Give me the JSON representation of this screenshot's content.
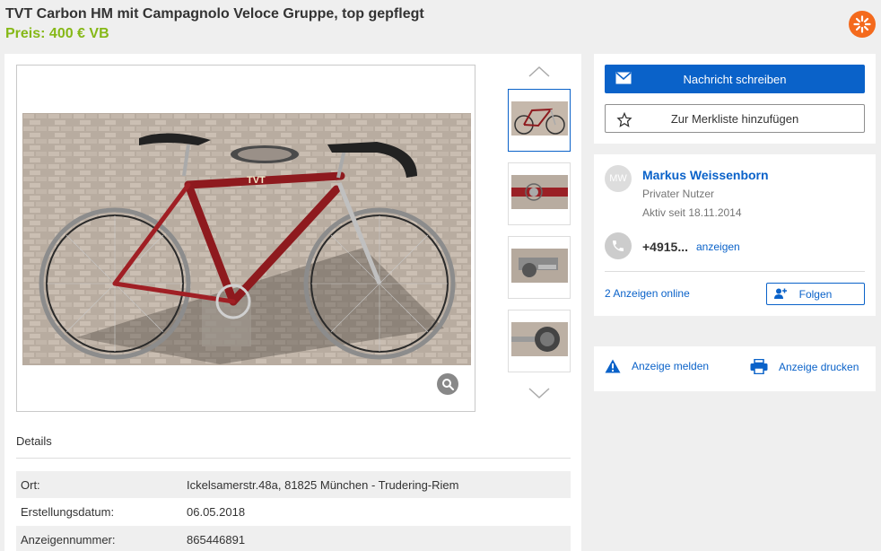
{
  "listing": {
    "title": "TVT Carbon HM mit Campagnolo Veloce Gruppe, top gepflegt",
    "price": "Preis: 400 € VB"
  },
  "icons": {
    "brand": "burst-logo-icon",
    "zoom": "magnifier-icon",
    "mail": "envelope-icon",
    "star": "star-icon",
    "phone": "phone-icon",
    "follow": "user-plus-icon",
    "report": "warning-icon",
    "print": "printer-icon"
  },
  "details": {
    "heading": "Details",
    "rows": [
      {
        "label": "Ort:",
        "value": "Ickelsamerstr.48a, 81825 München - Trudering-Riem"
      },
      {
        "label": "Erstellungsdatum:",
        "value": "06.05.2018"
      },
      {
        "label": "Anzeigennummer:",
        "value": "865446891"
      }
    ]
  },
  "actions": {
    "message": "Nachricht schreiben",
    "watchlist": "Zur Merkliste hinzufügen"
  },
  "seller": {
    "initials": "MW",
    "name": "Markus Weissenborn",
    "type": "Privater Nutzer",
    "active_since": "Aktiv seit 18.11.2014",
    "phone_partial": "+4915...",
    "phone_show": "anzeigen",
    "ads_online": "2 Anzeigen online",
    "follow": "Folgen"
  },
  "footer_actions": {
    "report": "Anzeige melden",
    "print": "Anzeige drucken"
  },
  "colors": {
    "accent": "#0a62c9",
    "price": "#86b817",
    "brand": "#f46a1d"
  }
}
